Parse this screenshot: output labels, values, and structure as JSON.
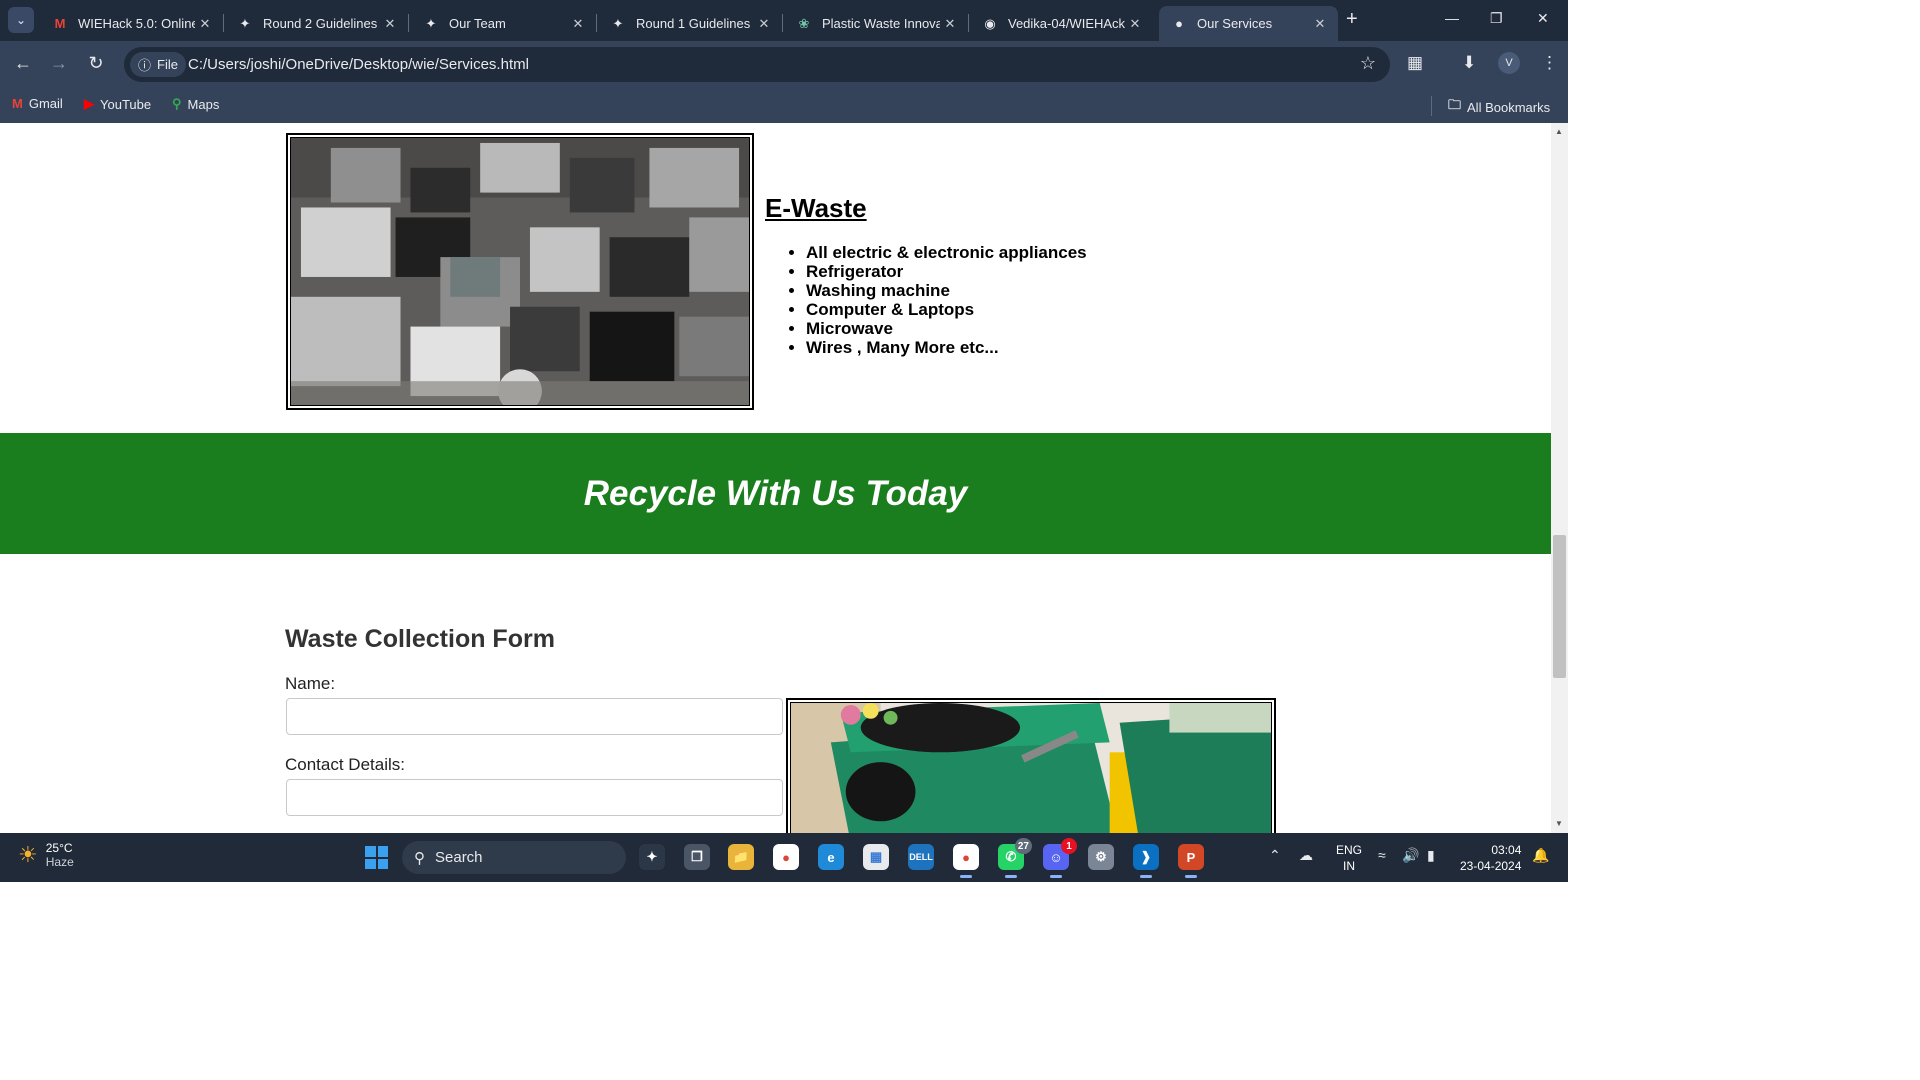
{
  "browser": {
    "tabs": [
      {
        "title": "WIEHack 5.0: Online",
        "icon": "gmail-icon"
      },
      {
        "title": "Round 2 Guidelines",
        "icon": "devfolio-icon"
      },
      {
        "title": "Our Team",
        "icon": "devfolio-icon"
      },
      {
        "title": "Round 1 Guidelines",
        "icon": "devfolio-icon"
      },
      {
        "title": "Plastic Waste Innova",
        "icon": "chatgpt-icon"
      },
      {
        "title": "Vedika-04/WIEHAck",
        "icon": "github-icon"
      },
      {
        "title": "Our Services",
        "icon": "globe-icon",
        "active": true
      }
    ],
    "address": {
      "chip_label": "File",
      "url": "C:/Users/joshi/OneDrive/Desktop/wie/Services.html"
    },
    "profile_initial": "V",
    "bookmarks": [
      {
        "label": "Gmail",
        "icon": "gmail-icon"
      },
      {
        "label": "YouTube",
        "icon": "youtube-icon"
      },
      {
        "label": "Maps",
        "icon": "maps-icon"
      }
    ],
    "all_bookmarks_label": "All Bookmarks"
  },
  "page": {
    "ewaste": {
      "heading": "E-Waste",
      "items": [
        "All electric & electronic appliances",
        "Refrigerator",
        "Washing machine",
        "Computer & Laptops",
        "Microwave",
        "Wires , Many More etc..."
      ]
    },
    "banner": {
      "text": "Recycle With Us Today",
      "color": "#1a7d1e"
    },
    "form": {
      "title": "Waste Collection Form",
      "name_label": "Name:",
      "name_value": "",
      "contact_label": "Contact Details:",
      "contact_value": ""
    }
  },
  "taskbar": {
    "weather": {
      "temp": "25°C",
      "condition": "Haze"
    },
    "search_placeholder": "Search",
    "badges": {
      "whatsapp": "27",
      "discord": "1"
    },
    "language": {
      "line1": "ENG",
      "line2": "IN"
    },
    "clock": {
      "time": "03:04",
      "date": "23-04-2024"
    }
  }
}
